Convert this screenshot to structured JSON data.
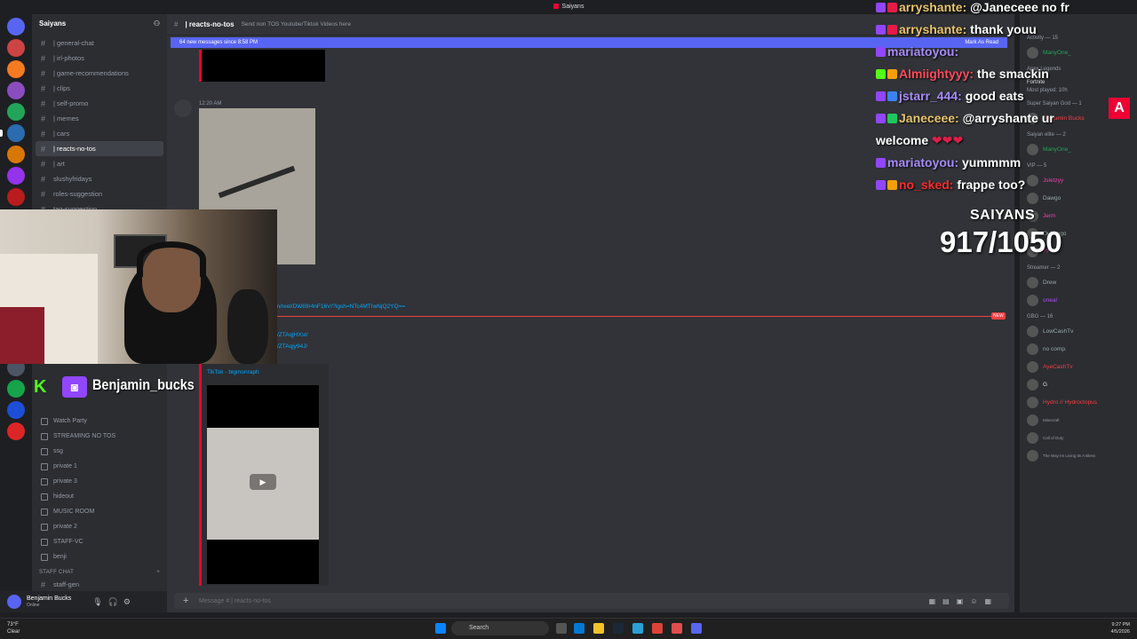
{
  "window": {
    "title": "Saiyans"
  },
  "server": {
    "name": "Saiyans"
  },
  "channels": [
    {
      "label": "| general-chat"
    },
    {
      "label": "| irl-photos"
    },
    {
      "label": "| game-recommendations"
    },
    {
      "label": "| clips"
    },
    {
      "label": "| self-promo"
    },
    {
      "label": "| memes"
    },
    {
      "label": "| cars"
    },
    {
      "label": "| reacts-no-tos"
    },
    {
      "label": "| art"
    },
    {
      "label": "slushyfridays"
    },
    {
      "label": "roles-suggestion"
    },
    {
      "label": "tag-suggestion"
    }
  ],
  "voice": [
    {
      "label": "Watch Party"
    },
    {
      "label": "STREAMING NO TOS"
    },
    {
      "label": "ssg"
    },
    {
      "label": "private 1"
    },
    {
      "label": "private 3"
    },
    {
      "label": "hideout"
    },
    {
      "label": "MUSIC ROOM"
    },
    {
      "label": "private 2"
    },
    {
      "label": "STAFF-VC"
    },
    {
      "label": "benji"
    }
  ],
  "staff_category": "STAFF CHAT",
  "staff_channel": "staff-gen",
  "user": {
    "name": "Benjamin Bucks",
    "status": "Online"
  },
  "header": {
    "channel": "| reacts-no-tos",
    "topic": "Send non TOS Youtube/Tiktok Videos here"
  },
  "new_messages": {
    "text": "64 new messages since 8:58 PM",
    "action": "Mark As Read"
  },
  "messages": {
    "time": "12:20 AM",
    "link1": "om/reel/DW69r4nF16V/?igsh=NTc4MTIwNjQ2YQ==",
    "link2": "/ZTAqjHXst/",
    "link3": "/ZTAqjy94J/",
    "tiktok_author": "TikTok - bigmonraph",
    "new_tag": "NEW"
  },
  "input": {
    "placeholder": "Message # | reacts-no-tos"
  },
  "members": {
    "activity": "Activity — 15",
    "activity_user": "ManyOne_",
    "game1": "Apex Legends",
    "game2": "Fortnite",
    "game2_sub": "Most played: 10h",
    "group1": "Super Saiyan God — 1",
    "member1": "Benjamin Bucks",
    "group2": "Saiyan elite — 2",
    "member2": "ManyOne_",
    "group3": "VIP — 5",
    "vip": [
      "Jsletzyy",
      "Dawgo",
      "Jerm",
      "OuUrago",
      "??"
    ],
    "group4": "Streamer — 2",
    "streamers": [
      "Drew",
      "oneal"
    ],
    "group5": "GBG — 16",
    "gbg": [
      "LowCashTv",
      "no comp.",
      "AyeCashTv",
      "G",
      "Hydro // Hydroctopus",
      "Minecraft",
      "Call of Duty",
      "The Way Im Living Its A Bless"
    ]
  },
  "overlay": {
    "chat": [
      {
        "user": "arryshante:",
        "text": "@Janeceee no fr",
        "color": "#e9c46a"
      },
      {
        "user": "arryshante:",
        "text": "thank youu",
        "color": "#e9c46a"
      },
      {
        "user": "mariatoyou:",
        "text": "",
        "color": "#a78bfa"
      },
      {
        "user": "Almiightyyy:",
        "text": "the smackin",
        "color": "#ff4b5c"
      },
      {
        "user": "jstarr_444:",
        "text": "good eats",
        "color": "#a78bfa"
      },
      {
        "user": "Janeceee:",
        "text": "@arryshante ur",
        "color": "#e9c46a"
      },
      {
        "user": "",
        "text": "welcome",
        "color": "#ffffff"
      },
      {
        "user": "mariatoyou:",
        "text": "yummmm",
        "color": "#a78bfa"
      },
      {
        "user": "no_sked:",
        "text": "frappe too?",
        "color": "#ff2d2d"
      }
    ],
    "goal_title": "SAIYANS",
    "goal_count": "917/1050",
    "streamer_name": "Benjamin_bucks"
  },
  "taskbar": {
    "weather_temp": "73°F",
    "weather_text": "Clear",
    "search": "Search",
    "time": "9:27 PM",
    "date": "4/5/2026"
  }
}
